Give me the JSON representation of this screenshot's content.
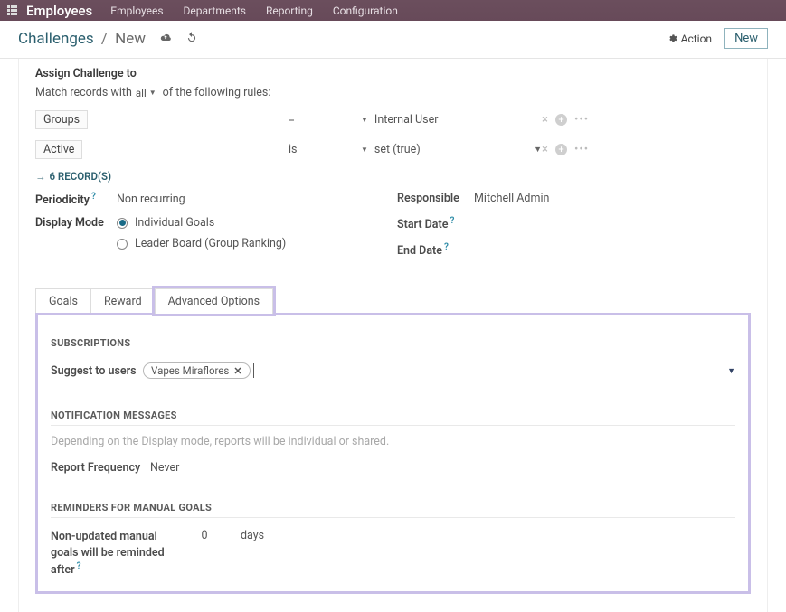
{
  "topbar": {
    "brand": "Employees",
    "menu": [
      "Employees",
      "Departments",
      "Reporting",
      "Configuration"
    ]
  },
  "subhead": {
    "root": "Challenges",
    "leaf": "New",
    "action_label": "Action",
    "new_label": "New"
  },
  "assign": {
    "title": "Assign Challenge to",
    "match_prefix": "Match records with",
    "match_scope": "all",
    "match_suffix": "of the following rules:",
    "rules": [
      {
        "field": "Groups",
        "op": "=",
        "value": "Internal User"
      },
      {
        "field": "Active",
        "op": "is",
        "value": "set (true)"
      }
    ],
    "records_link": "6 RECORD(S)"
  },
  "left": {
    "periodicity_label": "Periodicity",
    "periodicity_value": "Non recurring",
    "display_mode_label": "Display Mode",
    "display_options": [
      {
        "label": "Individual Goals",
        "selected": true
      },
      {
        "label": "Leader Board (Group Ranking)",
        "selected": false
      }
    ]
  },
  "right": {
    "responsible_label": "Responsible",
    "responsible_value": "Mitchell Admin",
    "start_label": "Start Date",
    "end_label": "End Date"
  },
  "tabs": [
    "Goals",
    "Reward",
    "Advanced Options"
  ],
  "adv": {
    "subs_title": "SUBSCRIPTIONS",
    "suggest_label": "Suggest to users",
    "suggest_chip": "Vapes Miraflores",
    "notif_title": "NOTIFICATION MESSAGES",
    "notif_help": "Depending on the Display mode, reports will be individual or shared.",
    "report_freq_label": "Report Frequency",
    "report_freq_value": "Never",
    "rem_title": "REMINDERS FOR MANUAL GOALS",
    "rem_label": "Non-updated manual goals will be reminded after",
    "rem_value": "0",
    "rem_unit": "days"
  }
}
